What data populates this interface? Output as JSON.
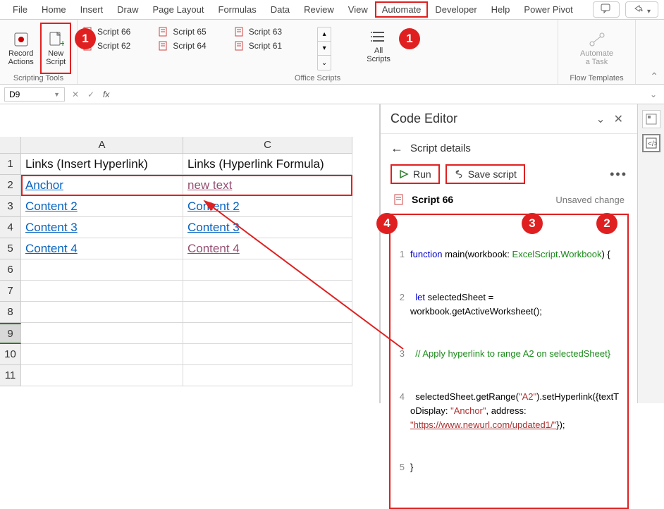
{
  "ribbon": {
    "tabs": [
      "File",
      "Home",
      "Insert",
      "Draw",
      "Page Layout",
      "Formulas",
      "Data",
      "Review",
      "View",
      "Automate",
      "Developer",
      "Help",
      "Power Pivot"
    ],
    "active_tab": "Automate",
    "groups": {
      "scripting_tools": {
        "label": "Scripting Tools",
        "record": "Record\nActions",
        "new_script": "New\nScript"
      },
      "office_scripts": {
        "label": "Office Scripts",
        "items": [
          [
            "Script 66",
            "Script 62"
          ],
          [
            "Script 65",
            "Script 64"
          ],
          [
            "Script 63",
            "Script 61"
          ]
        ],
        "all_scripts": "All\nScripts"
      },
      "flow_templates": {
        "label": "Flow Templates",
        "automate_task": "Automate\na Task"
      }
    }
  },
  "formula_bar": {
    "name_box": "D9",
    "fx": "fx"
  },
  "grid": {
    "columns": [
      "A",
      "C"
    ],
    "rows": [
      "1",
      "2",
      "3",
      "4",
      "5",
      "6",
      "7",
      "8",
      "9",
      "10",
      "11"
    ],
    "cells": {
      "A1": "Links (Insert Hyperlink)",
      "C1": "Links (Hyperlink Formula)",
      "A2": "Anchor",
      "C2": "new text",
      "A3": "Content 2",
      "C3": "Content 2",
      "A4": "Content 3",
      "C4": "Content 3",
      "A5": "Content 4",
      "C5": "Content 4"
    },
    "selected_row": "9"
  },
  "pane": {
    "title": "Code Editor",
    "subtitle": "Script details",
    "run": "Run",
    "save": "Save script",
    "script_name": "Script 66",
    "status": "Unsaved change",
    "code": {
      "l1a": "function",
      "l1b": " main(workbook: ",
      "l1c": "ExcelScript",
      "l1d": ".",
      "l1e": "Workbook",
      "l1f": ") {",
      "l2a": "let",
      "l2b": " selectedSheet = workbook.getActiveWorksheet();",
      "l3": "// Apply hyperlink to range A2 on selectedSheet}",
      "l4a": "selectedSheet.getRange(",
      "l4b": "\"A2\"",
      "l4c": ").setHyperlink({textToDisplay: ",
      "l4d": "\"Anchor\"",
      "l4e": ", address: ",
      "l4f": "\"https://www.newurl.com/updated1/\"",
      "l4g": "});",
      "l5": "}"
    }
  },
  "annotations": {
    "n1": "1",
    "n2": "2",
    "n3": "3",
    "n4": "4"
  }
}
